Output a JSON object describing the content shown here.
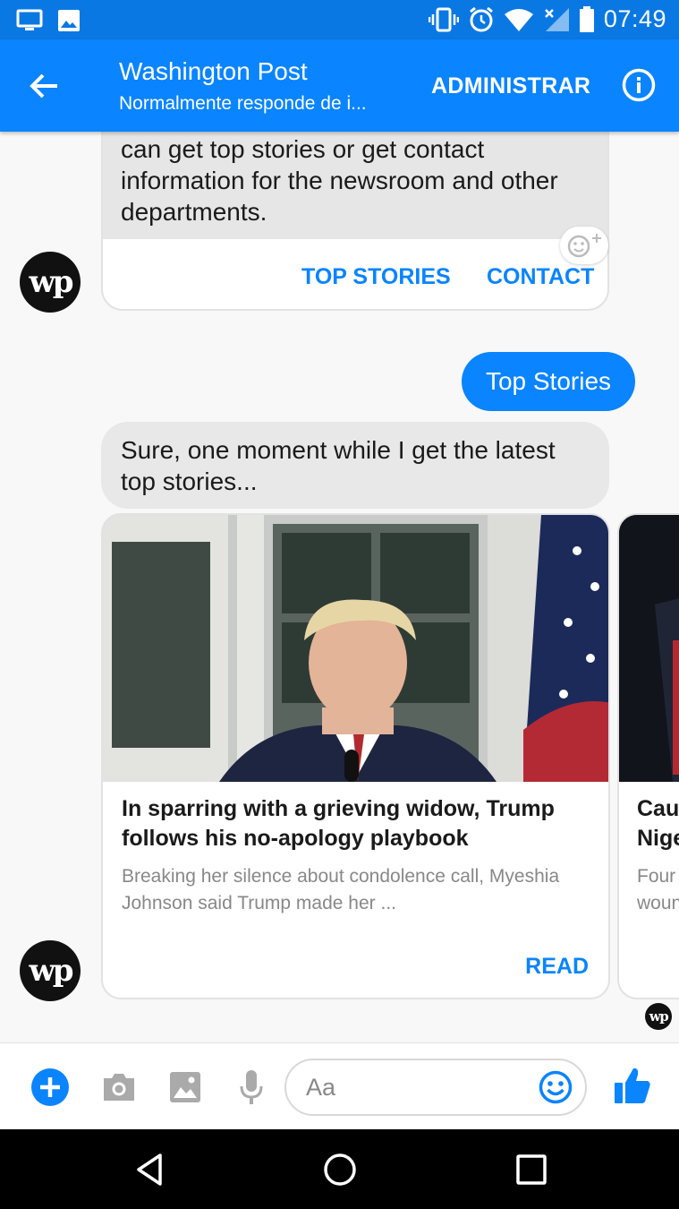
{
  "status_bar": {
    "time": "07:49",
    "icons": [
      "screen-cast-icon",
      "image-icon",
      "vibrate-icon",
      "alarm-icon",
      "wifi-icon",
      "no-signal-icon",
      "battery-icon"
    ]
  },
  "header": {
    "title": "Washington Post",
    "subtitle": "Normalmente responde de i...",
    "manage_label": "ADMINISTRAR",
    "icons": [
      "back-arrow-icon",
      "info-icon"
    ]
  },
  "bot": {
    "avatar_text": "wp"
  },
  "messages": {
    "intro_text": "can get top stories or get contact information for the newsroom and other departments.",
    "quick_reply_1": "TOP STORIES",
    "quick_reply_2": "CONTACT",
    "user_message": "Top Stories",
    "bot_reply": "Sure, one moment while I get the latest top stories..."
  },
  "stories": [
    {
      "headline": "In sparring with a grieving widow, Trump follows his no-apology playbook",
      "description": "Breaking her silence about condolence call, Myeshia Johnson said Trump made her ...",
      "action": "READ"
    },
    {
      "headline": "Cau\nNige",
      "description": "Four\nwoun"
    }
  ],
  "composer": {
    "placeholder": "Aa",
    "icons": [
      "plus-icon",
      "camera-icon",
      "gallery-icon",
      "microphone-icon",
      "emoji-icon",
      "thumbs-up-icon"
    ]
  },
  "colors": {
    "accent": "#0a84ff",
    "status_bar": "#0a78e3"
  }
}
